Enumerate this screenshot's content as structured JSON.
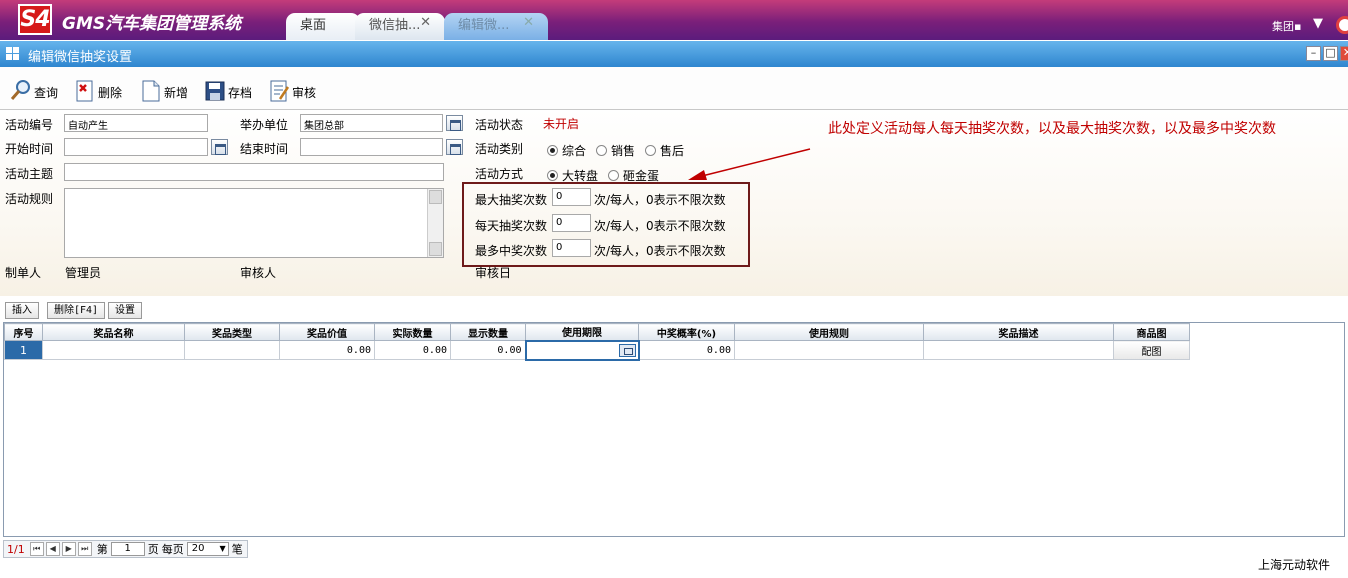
{
  "app": {
    "logo": "S4",
    "title": "GMS汽车集团管理系统",
    "group_label": "集团▪",
    "colors": {
      "header": "#7a1f7a",
      "titlebar": "#2f86cf",
      "annotation": "#c00000",
      "row_selected": "#2b6aa8"
    }
  },
  "tabs": [
    {
      "label": "桌面",
      "closable": false
    },
    {
      "label": "微信抽...",
      "closable": true
    },
    {
      "label": "编辑微...",
      "closable": true
    }
  ],
  "window": {
    "title": "编辑微信抽奖设置"
  },
  "toolbar": {
    "query": "查询",
    "delete": "删除",
    "new": "新增",
    "save": "存档",
    "audit": "审核"
  },
  "form": {
    "labels": {
      "activity_no": "活动编号",
      "organizer": "举办单位",
      "activity_status": "活动状态",
      "start_time": "开始时间",
      "end_time": "结束时间",
      "activity_category": "活动类别",
      "subject": "活动主题",
      "activity_mode": "活动方式",
      "rules": "活动规则",
      "max_draws": "最大抽奖次数",
      "daily_draws": "每天抽奖次数",
      "max_wins": "最多中奖次数",
      "creator": "制单人",
      "auditor": "审核人",
      "audit_date": "审核日"
    },
    "values": {
      "activity_no": "自动产生",
      "organizer": "集团总部",
      "activity_status": "未开启",
      "start_time": "",
      "end_time": "",
      "subject": "",
      "rules": "",
      "max_draws": "0",
      "daily_draws": "0",
      "max_wins": "0",
      "creator": "管理员"
    },
    "category_options": [
      {
        "label": "综合",
        "checked": true
      },
      {
        "label": "销售",
        "checked": false
      },
      {
        "label": "售后",
        "checked": false
      }
    ],
    "mode_options": [
      {
        "label": "大转盘",
        "checked": true
      },
      {
        "label": "砸金蛋",
        "checked": false
      }
    ],
    "unit_text": "次/每人，0表示不限次数",
    "annotation": "此处定义活动每人每天抽奖次数，以及最大抽奖次数，以及最多中奖次数"
  },
  "grid": {
    "buttons": {
      "insert": "插入",
      "delete": "删除[F4]",
      "settings": "设置"
    },
    "columns": [
      "序号",
      "奖品名称",
      "奖品类型",
      "奖品价值",
      "实际数量",
      "显示数量",
      "使用期限",
      "中奖概率(%)",
      "使用规则",
      "奖品描述",
      "商品图"
    ],
    "rows": [
      {
        "no": "1",
        "name": "",
        "type": "",
        "value": "0.00",
        "actual_qty": "0.00",
        "display_qty": "0.00",
        "expiry": "",
        "probability": "0.00",
        "usage_rule": "",
        "description": "",
        "image": "配图"
      }
    ]
  },
  "pager": {
    "status": "1/1",
    "page_prefix": "第",
    "page": "1",
    "page_suffix": "页",
    "per_page_label": "每页",
    "per_page": "20",
    "unit": "笔"
  },
  "footer": {
    "company": "上海元动软件"
  }
}
